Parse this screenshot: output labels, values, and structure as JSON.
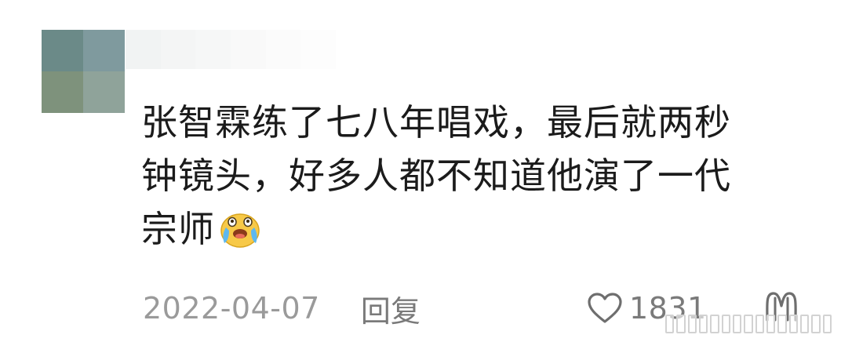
{
  "comment": {
    "text_line1": "张智霖练了七八年唱戏，最后就两秒",
    "text_line2": "钟镜头，好多人都不知道他演了一代",
    "text_line3": "宗师",
    "emoji_name": "crying-laughing-emoji",
    "date": "2022-04-07",
    "reply_label": "回复",
    "like_count": "1831"
  },
  "colors": {
    "text": "#1b1b1b",
    "meta": "#9a9a9a",
    "action": "#7a7a7a"
  },
  "icons": [
    "avatar-blurred",
    "heart-icon",
    "dislike-icon",
    "crying-laughing-emoji"
  ]
}
